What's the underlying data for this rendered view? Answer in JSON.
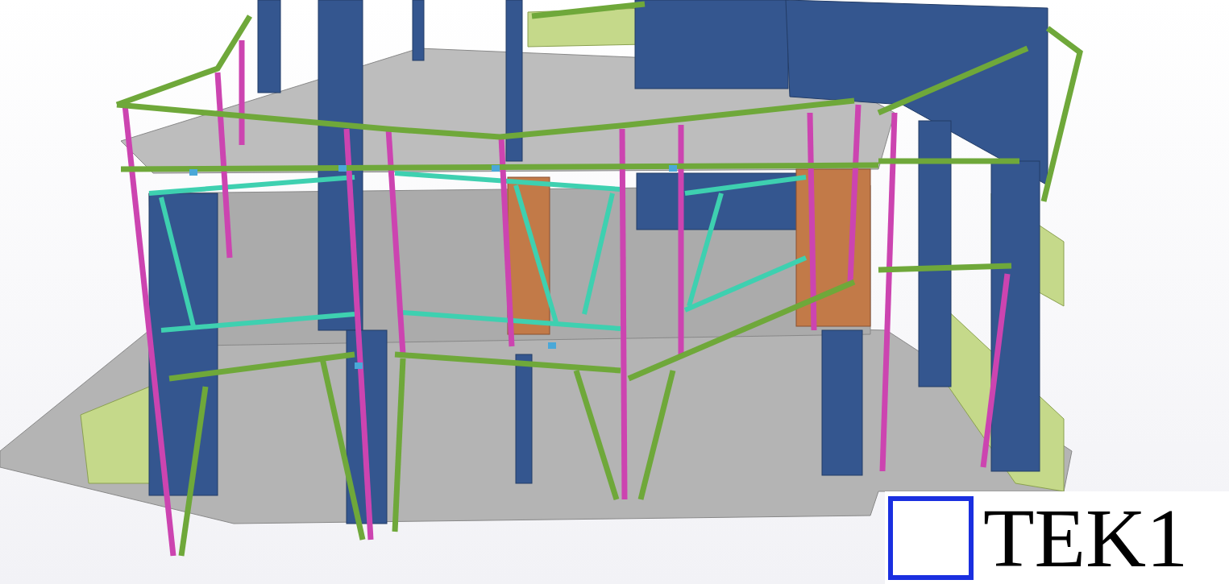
{
  "viewport": {
    "logo": {
      "text": "TEK1"
    }
  }
}
